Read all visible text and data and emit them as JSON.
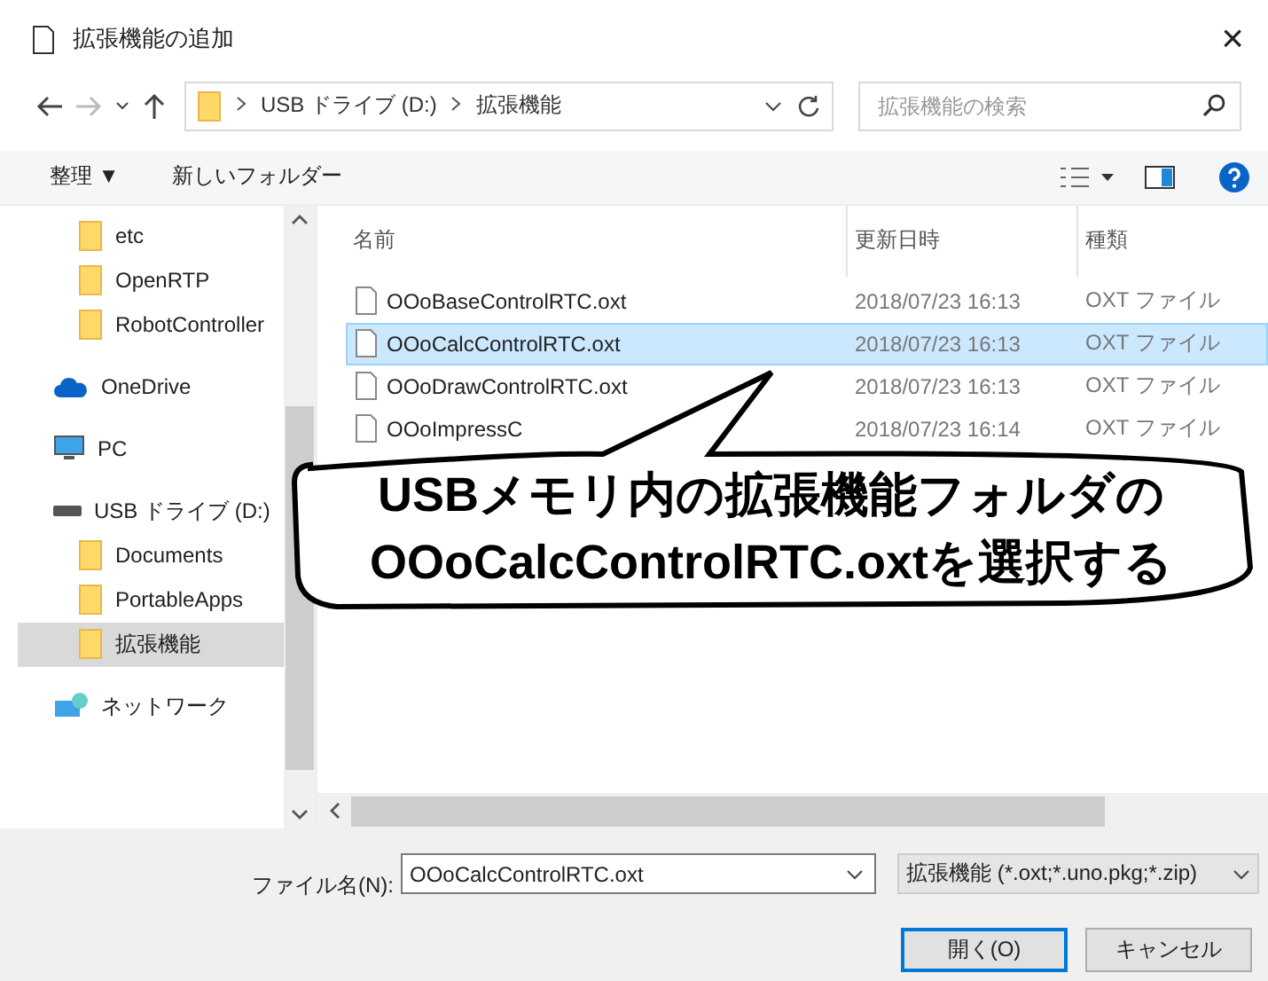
{
  "window": {
    "title": "拡張機能の追加",
    "close": "×"
  },
  "address": {
    "crumbs": [
      "USB ドライブ (D:)",
      "拡張機能"
    ],
    "search_placeholder": "拡張機能の検索"
  },
  "toolbar": {
    "organize": "整理 ▼",
    "new_folder": "新しいフォルダー"
  },
  "sidebar": {
    "items": [
      {
        "kind": "folder",
        "label": "etc",
        "selected": false
      },
      {
        "kind": "folder",
        "label": "OpenRTP",
        "selected": false
      },
      {
        "kind": "folder",
        "label": "RobotController",
        "selected": false
      },
      {
        "kind": "cloud",
        "label": "OneDrive",
        "selected": false
      },
      {
        "kind": "pc",
        "label": "PC",
        "selected": false
      },
      {
        "kind": "drive",
        "label": "USB ドライブ (D:)",
        "selected": false,
        "children": [
          {
            "kind": "folder",
            "label": "Documents",
            "selected": false
          },
          {
            "kind": "folder",
            "label": "PortableApps",
            "selected": false
          },
          {
            "kind": "folder",
            "label": "拡張機能",
            "selected": true
          }
        ]
      },
      {
        "kind": "network",
        "label": "ネットワーク",
        "selected": false
      }
    ]
  },
  "table": {
    "columns": [
      "名前",
      "更新日時",
      "種類"
    ],
    "rows": [
      {
        "name": "OOoBaseControlRTC.oxt",
        "date": "2018/07/23 16:13",
        "type": "OXT ファイル",
        "selected": false
      },
      {
        "name": "OOoCalcControlRTC.oxt",
        "date": "2018/07/23 16:13",
        "type": "OXT ファイル",
        "selected": true
      },
      {
        "name": "OOoDrawControlRTC.oxt",
        "date": "2018/07/23 16:13",
        "type": "OXT ファイル",
        "selected": false
      },
      {
        "name": "OOoImpressC",
        "date": "2018/07/23 16:14",
        "type": "OXT ファイル",
        "selected": false
      }
    ]
  },
  "footer": {
    "filename_label": "ファイル名(N):",
    "filename": "OOoCalcControlRTC.oxt",
    "filter": "拡張機能 (*.oxt;*.uno.pkg;*.zip)",
    "open": "開く(O)",
    "cancel": "キャンセル"
  },
  "callout": {
    "lines": [
      "USBメモリ内の拡張機能フォルダの",
      "OOoCalcControlRTC.oxtを選択する"
    ]
  }
}
